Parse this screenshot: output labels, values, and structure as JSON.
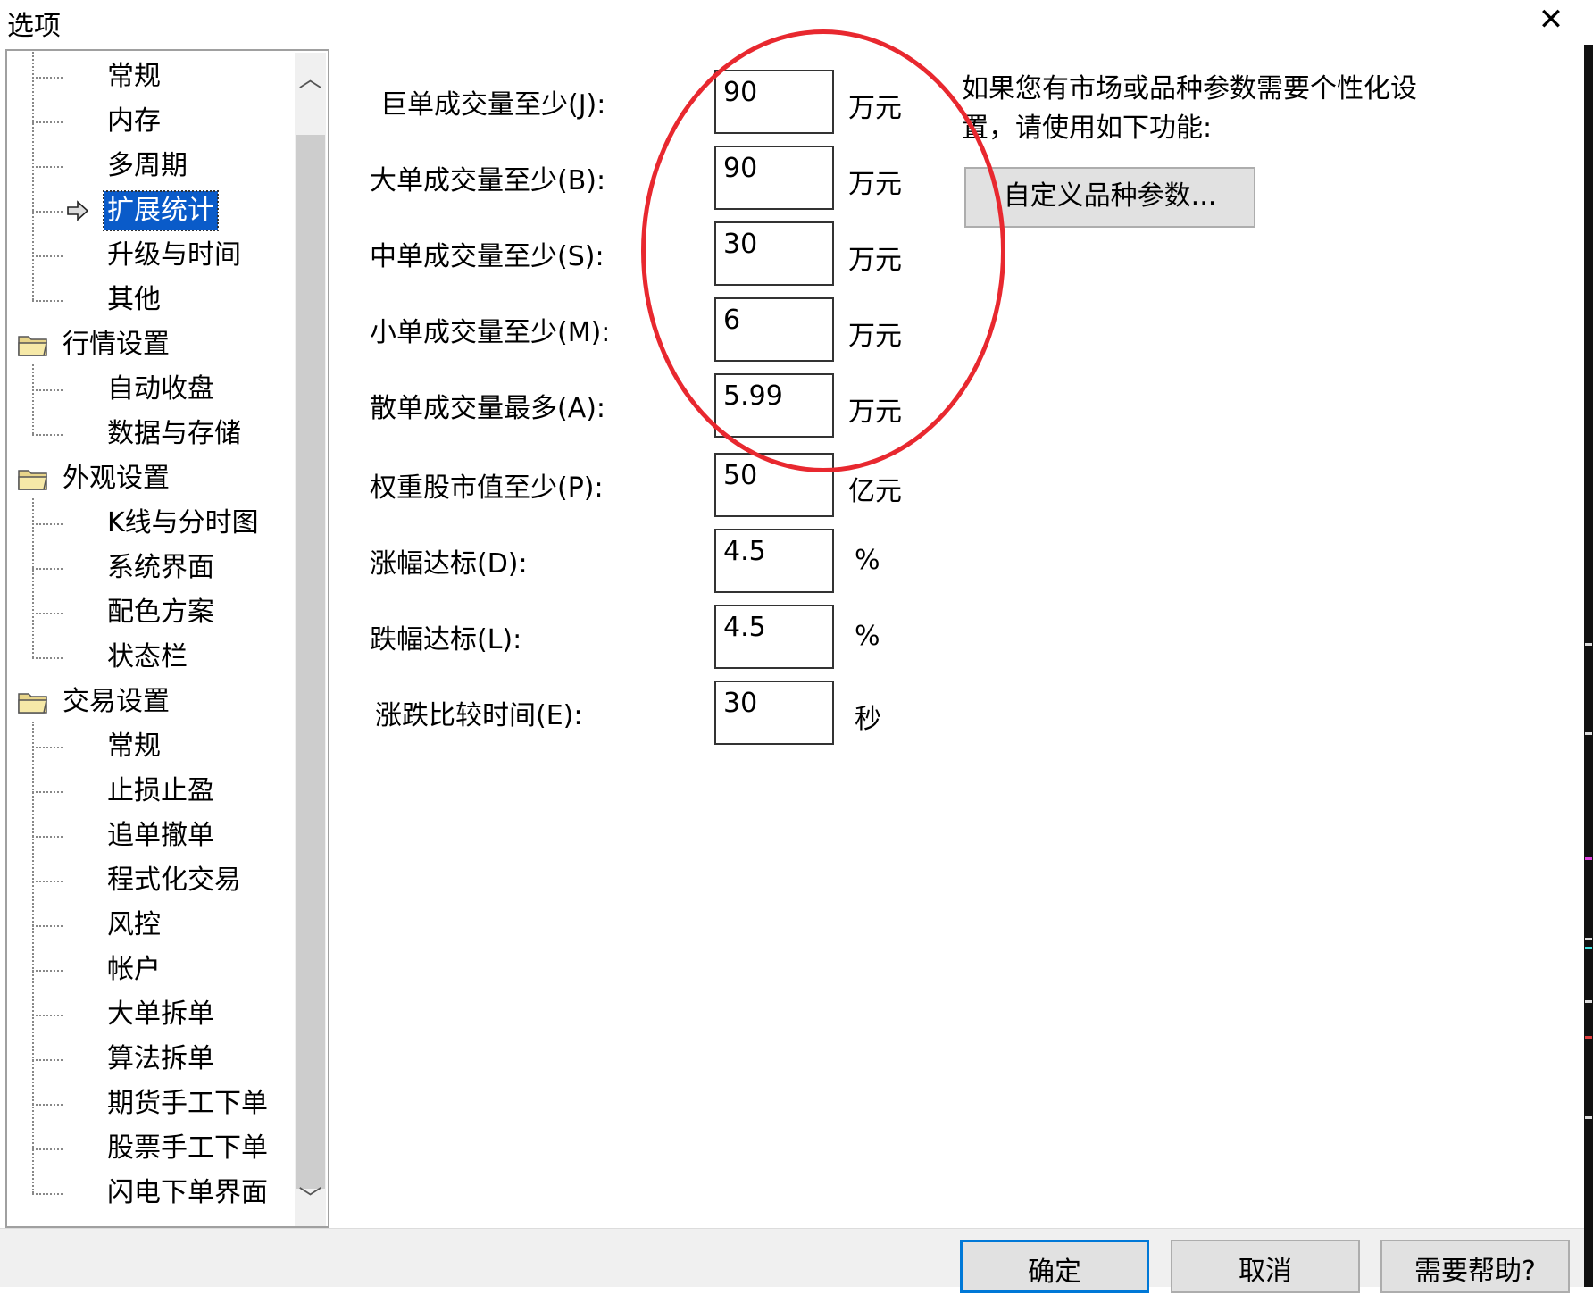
{
  "window": {
    "title": "选项",
    "close_glyph": "✕"
  },
  "tree": {
    "items": [
      {
        "label": "常规",
        "type": "child"
      },
      {
        "label": "内存",
        "type": "child"
      },
      {
        "label": "多周期",
        "type": "child"
      },
      {
        "label": "扩展统计",
        "type": "child",
        "selected": true
      },
      {
        "label": "升级与时间",
        "type": "child"
      },
      {
        "label": "其他",
        "type": "child"
      },
      {
        "label": "行情设置",
        "type": "folder"
      },
      {
        "label": "自动收盘",
        "type": "child"
      },
      {
        "label": "数据与存储",
        "type": "child"
      },
      {
        "label": "外观设置",
        "type": "folder"
      },
      {
        "label": "K线与分时图",
        "type": "child"
      },
      {
        "label": "系统界面",
        "type": "child"
      },
      {
        "label": "配色方案",
        "type": "child"
      },
      {
        "label": "状态栏",
        "type": "child"
      },
      {
        "label": "交易设置",
        "type": "folder"
      },
      {
        "label": "常规",
        "type": "child"
      },
      {
        "label": "止损止盈",
        "type": "child"
      },
      {
        "label": "追单撤单",
        "type": "child"
      },
      {
        "label": "程式化交易",
        "type": "child"
      },
      {
        "label": "风控",
        "type": "child"
      },
      {
        "label": "帐户",
        "type": "child"
      },
      {
        "label": "大单拆单",
        "type": "child"
      },
      {
        "label": "算法拆单",
        "type": "child"
      },
      {
        "label": "期货手工下单",
        "type": "child"
      },
      {
        "label": "股票手工下单",
        "type": "child"
      },
      {
        "label": "闪电下单界面",
        "type": "child"
      }
    ],
    "scroll_up_glyph": "︿",
    "scroll_down_glyph": "﹀"
  },
  "form": {
    "rows": [
      {
        "label": "巨单成交量至少(J):",
        "value": "90",
        "unit": "万元"
      },
      {
        "label": "大单成交量至少(B):",
        "value": "90",
        "unit": "万元"
      },
      {
        "label": "中单成交量至少(S):",
        "value": "30",
        "unit": "万元"
      },
      {
        "label": "小单成交量至少(M):",
        "value": "6",
        "unit": "万元"
      },
      {
        "label": "散单成交量最多(A):",
        "value": "5.99",
        "unit": "万元"
      },
      {
        "label": "权重股市值至少(P):",
        "value": "50",
        "unit": "亿元"
      },
      {
        "label": "涨幅达标(D):",
        "value": "4.5",
        "unit": "%"
      },
      {
        "label": "跌幅达标(L):",
        "value": "4.5",
        "unit": "%"
      },
      {
        "label": "涨跌比较时间(E):",
        "value": "30",
        "unit": "秒"
      }
    ],
    "hint": "如果您有市场或品种参数需要个性化设置，请使用如下功能:",
    "custom_button": "自定义品种参数..."
  },
  "buttons": {
    "ok": "确定",
    "cancel": "取消",
    "help": "需要帮助?"
  },
  "colors": {
    "selection": "#0a5bc9",
    "annotation": "#e8282f",
    "default_button_border": "#0078d7"
  }
}
